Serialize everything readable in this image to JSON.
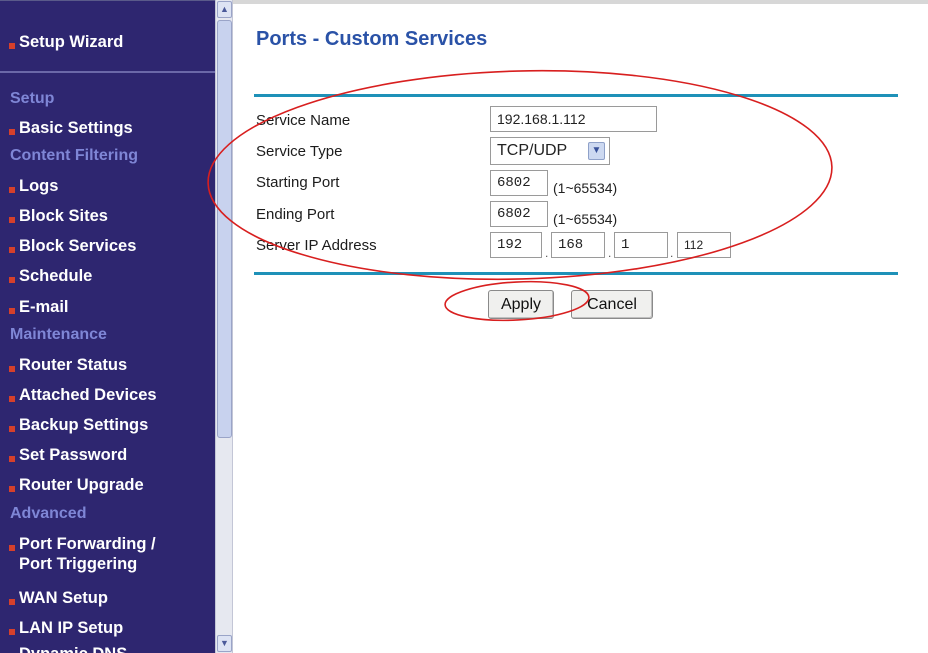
{
  "sidebar": {
    "items": [
      {
        "type": "item",
        "label": "Setup Wizard"
      },
      {
        "type": "section",
        "label": "Setup"
      },
      {
        "type": "item",
        "label": "Basic Settings"
      },
      {
        "type": "section",
        "label": "Content Filtering"
      },
      {
        "type": "item",
        "label": "Logs"
      },
      {
        "type": "item",
        "label": "Block Sites"
      },
      {
        "type": "item",
        "label": "Block Services"
      },
      {
        "type": "item",
        "label": "Schedule"
      },
      {
        "type": "item",
        "label": "E-mail"
      },
      {
        "type": "section",
        "label": "Maintenance"
      },
      {
        "type": "item",
        "label": "Router Status"
      },
      {
        "type": "item",
        "label": "Attached Devices"
      },
      {
        "type": "item",
        "label": "Backup Settings"
      },
      {
        "type": "item",
        "label": "Set Password"
      },
      {
        "type": "item",
        "label": "Router Upgrade"
      },
      {
        "type": "section",
        "label": "Advanced"
      },
      {
        "type": "item",
        "label": "Port Forwarding /\nPort Triggering"
      },
      {
        "type": "item",
        "label": "WAN Setup"
      },
      {
        "type": "item",
        "label": "LAN IP Setup"
      },
      {
        "type": "item",
        "label": "Dynamic DNS"
      }
    ]
  },
  "page": {
    "title": "Ports - Custom Services"
  },
  "form": {
    "service_name_label": "Service Name",
    "service_name_value": "192.168.1.112",
    "service_type_label": "Service Type",
    "service_type_value": "TCP/UDP",
    "starting_port_label": "Starting Port",
    "starting_port_value": "6802",
    "starting_port_range": "(1~65534)",
    "ending_port_label": "Ending Port",
    "ending_port_value": "6802",
    "ending_port_range": "(1~65534)",
    "server_ip_label": "Server IP Address",
    "server_ip_octets": [
      "192",
      "168",
      "1",
      "112"
    ]
  },
  "buttons": {
    "apply": "Apply",
    "cancel": "Cancel"
  },
  "colors": {
    "sidebar_bg": "#2e2670",
    "sidebar_section": "#7f86d6",
    "bullet": "#d6402b",
    "title": "#2a52a7",
    "rule": "#1e91b8",
    "annotation": "#d81f1f"
  }
}
